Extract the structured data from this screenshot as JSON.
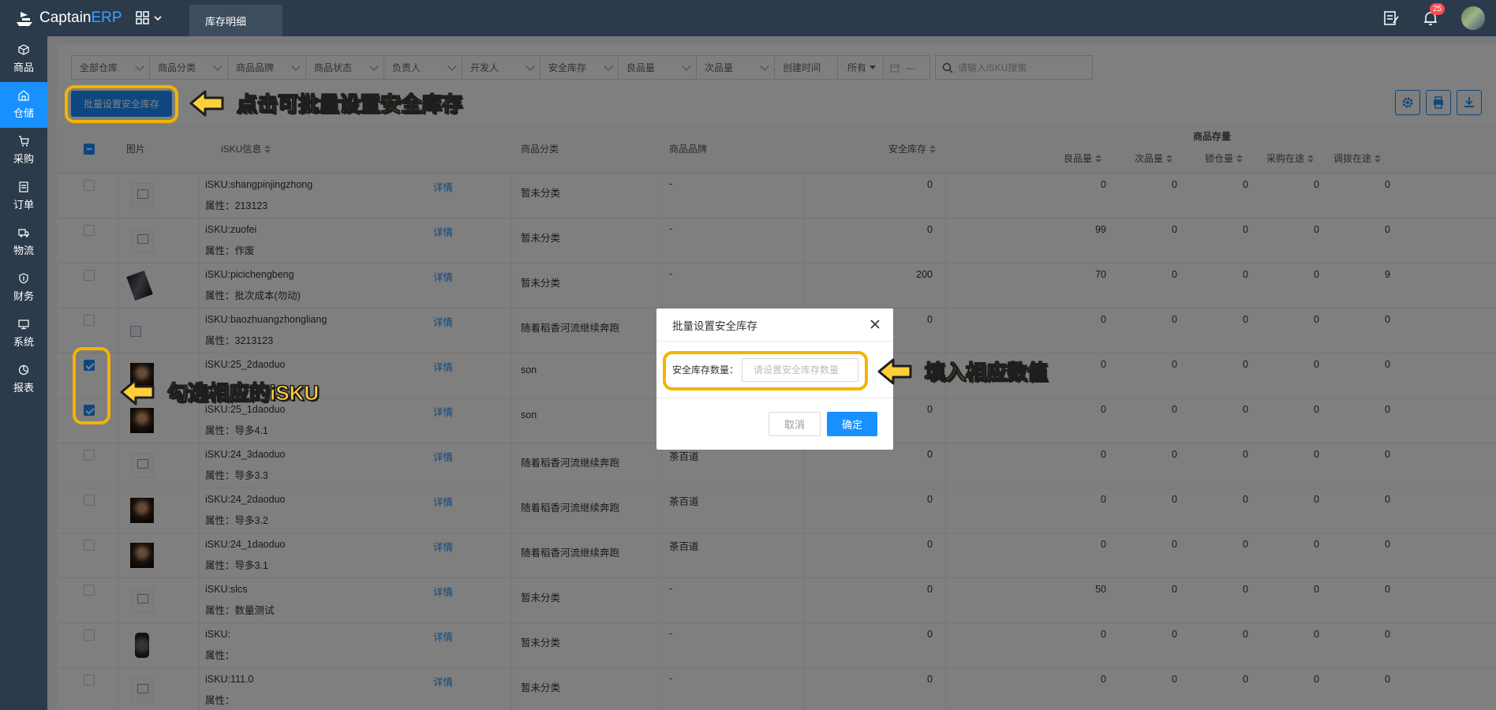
{
  "header": {
    "brand_a": "Captain",
    "brand_b": "ERP",
    "tab": "库存明细",
    "notification_count": "25"
  },
  "sidebar": {
    "items": [
      {
        "label": "商品",
        "icon": "cube-icon"
      },
      {
        "label": "仓储",
        "icon": "warehouse-icon",
        "active": true
      },
      {
        "label": "采购",
        "icon": "cart-icon"
      },
      {
        "label": "订单",
        "icon": "order-icon"
      },
      {
        "label": "物流",
        "icon": "truck-icon"
      },
      {
        "label": "财务",
        "icon": "finance-icon"
      },
      {
        "label": "系统",
        "icon": "system-icon"
      },
      {
        "label": "报表",
        "icon": "report-icon"
      }
    ]
  },
  "filters": {
    "warehouse": "全部仓库",
    "category": "商品分类",
    "brand": "商品品牌",
    "status": "商品状态",
    "owner": "负责人",
    "developer": "开发人",
    "safety_stock": "安全库存",
    "good_qty": "良品量",
    "defect_qty": "次品量",
    "created_time": "创建时间",
    "all": "所有",
    "date_sep": "—",
    "search_placeholder": "请输入iSKU搜索"
  },
  "toolbar": {
    "batch_label": "批量设置安全库存"
  },
  "table": {
    "headers": {
      "image": "图片",
      "isku": "iSKU信息",
      "category": "商品分类",
      "brand": "商品品牌",
      "safety_stock": "安全库存",
      "stock_group": "商品存量",
      "good": "良品量",
      "defect": "次品量",
      "lock": "锁仓量",
      "purchasing": "采购在途",
      "transfer": "调拨在途"
    },
    "detail_label": "详情",
    "rows": [
      {
        "sku": "iSKU:shangpinjingzhong",
        "attr": "属性：213123",
        "cat": "暂未分类",
        "brand": "-",
        "safety": "0",
        "good": "0",
        "defect": "0",
        "lock": "0",
        "purch": "0",
        "trans": "0",
        "checked": false,
        "img": "ph"
      },
      {
        "sku": "iSKU:zuofei",
        "attr": "属性：作废",
        "cat": "暂未分类",
        "brand": "-",
        "safety": "0",
        "good": "99",
        "defect": "0",
        "lock": "0",
        "purch": "0",
        "trans": "0",
        "checked": false,
        "img": "ph"
      },
      {
        "sku": "iSKU:picichengbeng",
        "attr": "属性：批次成本(勿动)",
        "cat": "暂未分类",
        "brand": "-",
        "safety": "200",
        "good": "70",
        "defect": "0",
        "lock": "0",
        "purch": "0",
        "trans": "9",
        "checked": false,
        "img": "phone"
      },
      {
        "sku": "iSKU:baozhuangzhongliang",
        "attr": "属性：3213123",
        "cat": "随着稻香河流继续奔跑",
        "brand": "",
        "safety": "0",
        "good": "0",
        "defect": "0",
        "lock": "0",
        "purch": "0",
        "trans": "0",
        "checked": false,
        "img": "broken"
      },
      {
        "sku": "iSKU:25_2daoduo",
        "attr": "",
        "cat": "son",
        "brand": "",
        "safety": "",
        "good": "0",
        "defect": "0",
        "lock": "0",
        "purch": "0",
        "trans": "0",
        "checked": true,
        "img": "portrait"
      },
      {
        "sku": "iSKU:25_1daoduo",
        "attr": "属性：导多4.1",
        "cat": "son",
        "brand": "",
        "safety": "0",
        "good": "0",
        "defect": "0",
        "lock": "0",
        "purch": "0",
        "trans": "0",
        "checked": true,
        "img": "portrait"
      },
      {
        "sku": "iSKU:24_3daoduo",
        "attr": "属性：导多3.3",
        "cat": "随着稻香河流继续奔跑",
        "brand": "茶百道",
        "safety": "0",
        "good": "0",
        "defect": "0",
        "lock": "0",
        "purch": "0",
        "trans": "0",
        "checked": false,
        "img": "ph"
      },
      {
        "sku": "iSKU:24_2daoduo",
        "attr": "属性：导多3.2",
        "cat": "随着稻香河流继续奔跑",
        "brand": "茶百道",
        "safety": "0",
        "good": "0",
        "defect": "0",
        "lock": "0",
        "purch": "0",
        "trans": "0",
        "checked": false,
        "img": "portrait"
      },
      {
        "sku": "iSKU:24_1daoduo",
        "attr": "属性：导多3.1",
        "cat": "随着稻香河流继续奔跑",
        "brand": "茶百道",
        "safety": "0",
        "good": "0",
        "defect": "0",
        "lock": "0",
        "purch": "0",
        "trans": "0",
        "checked": false,
        "img": "portrait"
      },
      {
        "sku": "iSKU:slcs",
        "attr": "属性：数量测试",
        "cat": "暂未分类",
        "brand": "-",
        "safety": "0",
        "good": "50",
        "defect": "0",
        "lock": "0",
        "purch": "0",
        "trans": "0",
        "checked": false,
        "img": "ph"
      },
      {
        "sku": "iSKU:",
        "attr": "属性：",
        "cat": "暂未分类",
        "brand": "-",
        "safety": "0",
        "good": "0",
        "defect": "0",
        "lock": "0",
        "purch": "0",
        "trans": "0",
        "checked": false,
        "img": "watch"
      },
      {
        "sku": "iSKU:111.0",
        "attr": "属性：",
        "cat": "暂未分类",
        "brand": "-",
        "safety": "0",
        "good": "0",
        "defect": "0",
        "lock": "0",
        "purch": "0",
        "trans": "0",
        "checked": false,
        "img": "ph"
      }
    ]
  },
  "modal": {
    "title": "批量设置安全库存",
    "field_label": "安全库存数量：",
    "placeholder": "请设置安全库存数量",
    "cancel": "取消",
    "ok": "确定"
  },
  "annotations": {
    "batch_note": "点击可批量设置安全库存",
    "check_note": "勾选相应的iSKU",
    "input_note": "填入相应数值",
    "highlight_color": "#f5b301"
  }
}
